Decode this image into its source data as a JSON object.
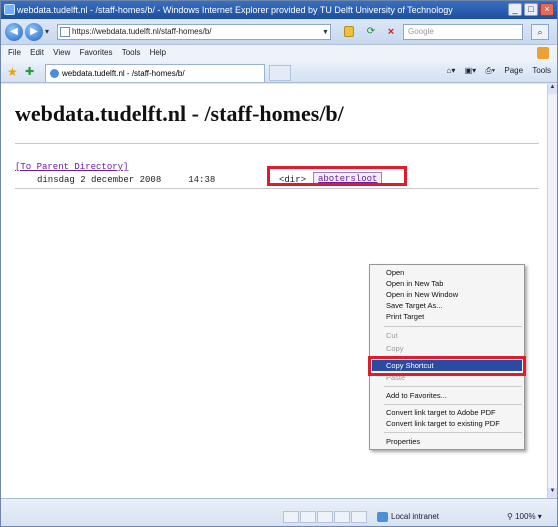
{
  "window": {
    "title": "webdata.tudelft.nl - /staff-homes/b/ - Windows Internet Explorer provided by TU Delft University of Technology",
    "buttons": {
      "minimize": "_",
      "maximize": "□",
      "close": "×"
    }
  },
  "address_bar": {
    "url": "https://webdata.tudelft.nl/staff-homes/b/",
    "search_placeholder": "Google"
  },
  "menu": [
    "File",
    "Edit",
    "View",
    "Favorites",
    "Tools",
    "Help"
  ],
  "tab": {
    "title": "webdata.tudelft.nl - /staff-homes/b/"
  },
  "command_bar": {
    "page": "Page",
    "tools": "Tools"
  },
  "page": {
    "heading": "webdata.tudelft.nl - /staff-homes/b/",
    "parent_link": "[To Parent Directory]",
    "row_date": "dinsdag 2 december 2008",
    "row_time": "14:38",
    "row_type": "<dir>",
    "row_name": "abotersloot"
  },
  "context_menu": {
    "items": [
      {
        "label": "Open",
        "enabled": true
      },
      {
        "label": "Open in New Tab",
        "enabled": true
      },
      {
        "label": "Open in New Window",
        "enabled": true
      },
      {
        "label": "Save Target As...",
        "enabled": true
      },
      {
        "label": "Print Target",
        "enabled": true
      },
      {
        "label": "Cut",
        "enabled": false
      },
      {
        "label": "Copy",
        "enabled": false
      },
      {
        "label": "Copy Shortcut",
        "enabled": true,
        "selected": true
      },
      {
        "label": "Paste",
        "enabled": false
      },
      {
        "label": "Add to Favorites...",
        "enabled": true
      },
      {
        "label": "Convert link target to Adobe PDF",
        "enabled": true
      },
      {
        "label": "Convert link target to existing PDF",
        "enabled": true
      },
      {
        "label": "Properties",
        "enabled": true
      }
    ]
  },
  "status_bar": {
    "zone": "Local intranet",
    "zoom": "100%"
  },
  "highlight_color": "#e01c2c"
}
